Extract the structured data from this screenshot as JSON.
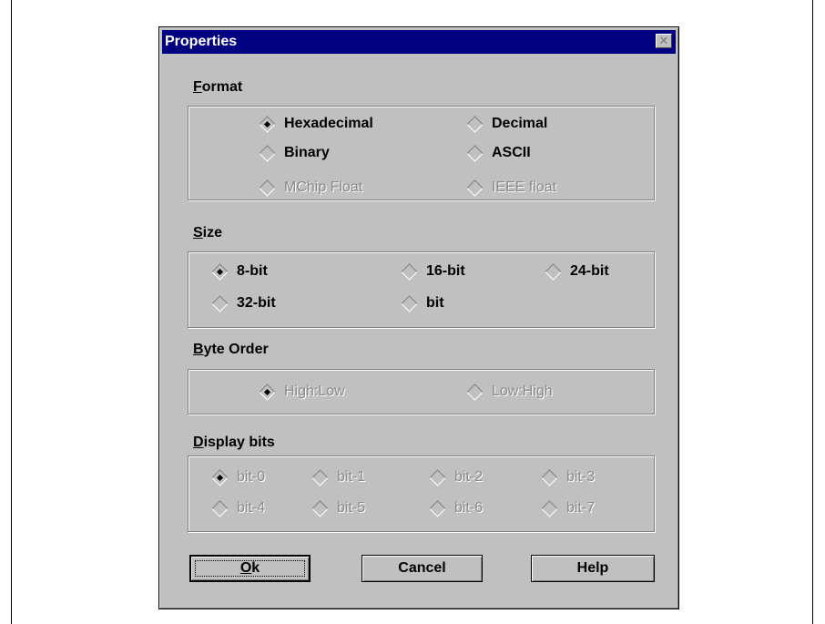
{
  "window": {
    "title": "Properties",
    "close_symbol": "✕"
  },
  "format": {
    "label_underlined": "F",
    "label_rest": "ormat",
    "options": [
      {
        "label": "Hexadecimal",
        "checked": true,
        "enabled": true
      },
      {
        "label": "Decimal",
        "checked": false,
        "enabled": true
      },
      {
        "label": "Binary",
        "checked": false,
        "enabled": true
      },
      {
        "label": "ASCII",
        "checked": false,
        "enabled": true
      },
      {
        "label": "MChip Float",
        "checked": false,
        "enabled": false
      },
      {
        "label": "IEEE float",
        "checked": false,
        "enabled": false
      }
    ]
  },
  "size": {
    "label_underlined": "S",
    "label_rest": "ize",
    "options": [
      {
        "label": "8-bit",
        "checked": true,
        "enabled": true
      },
      {
        "label": "16-bit",
        "checked": false,
        "enabled": true
      },
      {
        "label": "24-bit",
        "checked": false,
        "enabled": true
      },
      {
        "label": "32-bit",
        "checked": false,
        "enabled": true
      },
      {
        "label": "bit",
        "checked": false,
        "enabled": true
      }
    ]
  },
  "byte_order": {
    "label_underlined": "B",
    "label_rest": "yte Order",
    "options": [
      {
        "label": "High:Low",
        "checked": true,
        "enabled": false
      },
      {
        "label": "Low:High",
        "checked": false,
        "enabled": false
      }
    ]
  },
  "display_bits": {
    "label_underlined": "D",
    "label_rest": "isplay bits",
    "options": [
      {
        "label": "bit-0",
        "checked": true,
        "enabled": false
      },
      {
        "label": "bit-1",
        "checked": false,
        "enabled": false
      },
      {
        "label": "bit-2",
        "checked": false,
        "enabled": false
      },
      {
        "label": "bit-3",
        "checked": false,
        "enabled": false
      },
      {
        "label": "bit-4",
        "checked": false,
        "enabled": false
      },
      {
        "label": "bit-5",
        "checked": false,
        "enabled": false
      },
      {
        "label": "bit-6",
        "checked": false,
        "enabled": false
      },
      {
        "label": "bit-7",
        "checked": false,
        "enabled": false
      }
    ]
  },
  "buttons": {
    "ok_underlined": "O",
    "ok_rest": "k",
    "cancel": "Cancel",
    "help": "Help"
  },
  "colors": {
    "title_bar": "#000080",
    "dialog_face": "#c0c0c0",
    "disabled_text": "#8a8a8a"
  }
}
